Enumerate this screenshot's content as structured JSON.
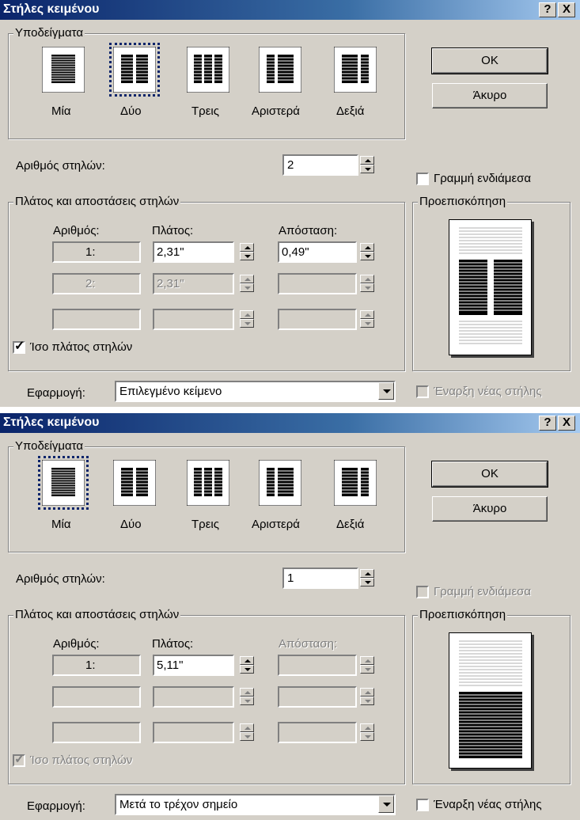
{
  "dialog_title": "Στήλες κειμένου",
  "help_glyph": "?",
  "close_glyph": "X",
  "presets_group": "Υποδείγματα",
  "presets": [
    "Μία",
    "Δύο",
    "Τρεις",
    "Αριστερά",
    "Δεξιά"
  ],
  "ok_label": "OK",
  "cancel_label": "Άκυρο",
  "num_cols_label": "Αριθμός στηλών:",
  "line_between_label": "Γραμμή ενδιάμεσα",
  "widths_group": "Πλάτος και αποστάσεις στηλών",
  "col_header_number": "Αριθμός:",
  "col_header_width": "Πλάτος:",
  "col_header_spacing": "Απόσταση:",
  "preview_group": "Προεπισκόπηση",
  "equal_width_label": "Ίσο πλάτος στηλών",
  "apply_label": "Εφαρμογή:",
  "new_column_label": "Έναρξη νέας στήλης",
  "check_glyph": "✓",
  "dialogs": [
    {
      "selected_preset": "Δύο",
      "num_cols_value": "2",
      "rows": [
        {
          "number": "1:",
          "width": "2,31\"",
          "spacing": "0,49\""
        },
        {
          "number": "2:",
          "width": "2,31\"",
          "spacing": ""
        },
        {
          "number": "",
          "width": "",
          "spacing": ""
        }
      ],
      "apply_value": "Επιλεγμένο κείμενο",
      "equal_width_checked": true,
      "line_between_checked": false,
      "new_column_checked": false
    },
    {
      "selected_preset": "Μία",
      "num_cols_value": "1",
      "rows": [
        {
          "number": "1:",
          "width": "5,11\"",
          "spacing": ""
        },
        {
          "number": "",
          "width": "",
          "spacing": ""
        },
        {
          "number": "",
          "width": "",
          "spacing": ""
        }
      ],
      "apply_value": "Μετά το τρέχον σημείο",
      "equal_width_checked": true,
      "line_between_checked": false,
      "new_column_checked": false
    }
  ]
}
